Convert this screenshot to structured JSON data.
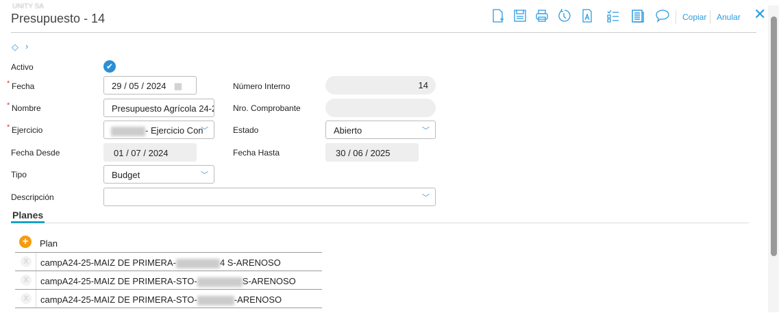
{
  "header": {
    "company": "UNITY SA",
    "title": "Presupuesto - 14"
  },
  "toolbar": {
    "icons": [
      "new-document-icon",
      "save-icon",
      "print-icon",
      "history-icon",
      "pdf-text-icon",
      "checklist-icon",
      "report-icon",
      "comment-icon"
    ],
    "copy_label": "Copiar",
    "cancel_label": "Anular"
  },
  "form": {
    "activo_label": "Activo",
    "activo_checked": true,
    "fecha_label": "Fecha",
    "fecha_value": "29 / 05 / 2024",
    "numero_interno_label": "Número Interno",
    "numero_interno_value": "14",
    "nombre_label": "Nombre",
    "nombre_value": "Presupuesto Agrícola 24-2",
    "nro_comprobante_label": "Nro. Comprobante",
    "nro_comprobante_value": "",
    "ejercicio_label": "Ejercicio",
    "ejercicio_value": "- Ejercicio Con",
    "estado_label": "Estado",
    "estado_value": "Abierto",
    "fecha_desde_label": "Fecha Desde",
    "fecha_desde_value": "01 / 07 / 2024",
    "fecha_hasta_label": "Fecha Hasta",
    "fecha_hasta_value": "30 / 06 / 2025",
    "tipo_label": "Tipo",
    "tipo_value": "Budget",
    "descripcion_label": "Descripción",
    "descripcion_value": ""
  },
  "tabs": {
    "planes": "Planes"
  },
  "table": {
    "header": "Plan",
    "rows": [
      {
        "a": "campA24-25-MAIZ DE PRIMERA-",
        "b": "4 S-ARENOSO"
      },
      {
        "a": "campA24-25-MAIZ DE PRIMERA-STO-",
        "b": "S-ARENOSO"
      },
      {
        "a": "campA24-25-MAIZ DE PRIMERA-STO-",
        "b": "-ARENOSO"
      }
    ]
  }
}
